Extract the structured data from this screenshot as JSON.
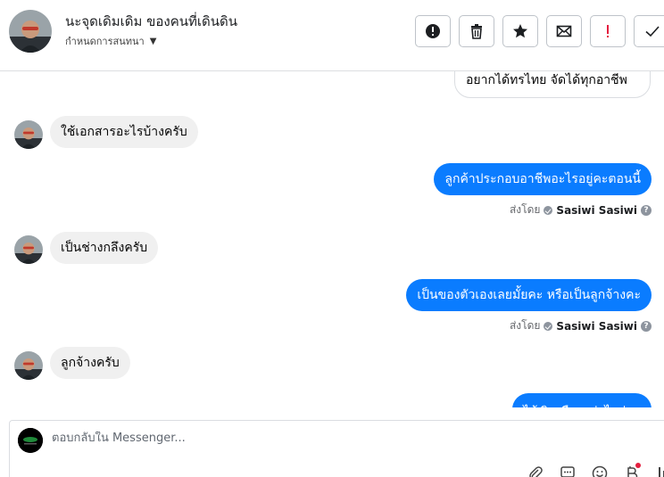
{
  "header": {
    "title": "นะจุดเดิมเดิม ของคนที่เดินดิน",
    "subtitle": "กำหนดการสนทนา",
    "actions": [
      {
        "icon": "alert-circle-icon"
      },
      {
        "icon": "trash-icon"
      },
      {
        "icon": "star-icon"
      },
      {
        "icon": "envelope-icon"
      },
      {
        "icon": "exclamation-icon"
      },
      {
        "icon": "checkmark-icon"
      }
    ]
  },
  "messages": {
    "top_partial": "อยากได้ทรไทย จัดได้ทุกอาชีพ",
    "m1": "ใช้เอกสารอะไรบ้างครับ",
    "m2": "ลูกค้าประกอบอาชีพอะไรอยู่คะตอนนี้",
    "m2_sentby_label": "ส่งโดย",
    "m2_sentby_name": "Sasiwi Sasiwi",
    "m3": "เป็นช่างกลึงครับ",
    "m4": "เป็นของตัวเองเลยมั้ยคะ หรือเป็นลูกจ้างคะ",
    "m4_sentby_label": "ส่งโดย",
    "m4_sentby_name": "Sasiwi Sasiwi",
    "m5": "ลูกจ้างครับ",
    "m6_partial": "ได้เงินเดือนเท่าไหร่คะ"
  },
  "composer": {
    "placeholder": "ตอบกลับใน Messenger...",
    "tools": [
      "paperclip-icon",
      "saved-reply-icon",
      "emoji-icon",
      "bitcoin-icon",
      "more-icon"
    ]
  },
  "colors": {
    "outgoing_bubble": "#0a7cff",
    "incoming_bubble": "#f0f0f0",
    "notification_dot": "#e41e3f",
    "exclamation": "#e41e3f"
  }
}
